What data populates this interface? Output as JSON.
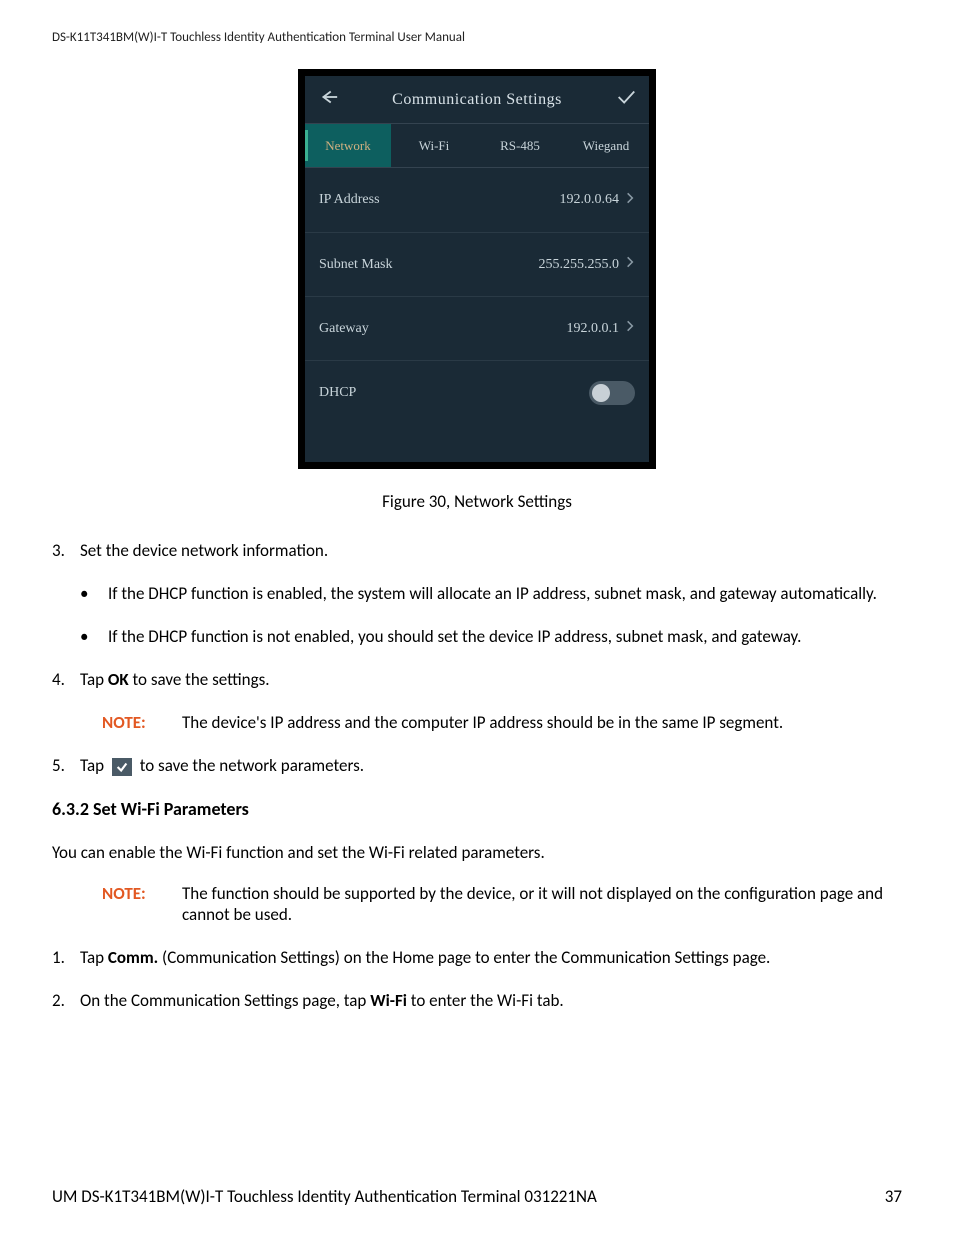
{
  "header": "DS-K11T341BM(W)I-T Touchless Identity Authentication Terminal User Manual",
  "device": {
    "title": "Communication Settings",
    "tabs": [
      "Network",
      "Wi-Fi",
      "RS-485",
      "Wiegand"
    ],
    "rows": {
      "ip": {
        "label": "IP Address",
        "value": "192.0.0.64"
      },
      "subnet": {
        "label": "Subnet Mask",
        "value": "255.255.255.0"
      },
      "gateway": {
        "label": "Gateway",
        "value": "192.0.0.1"
      },
      "dhcp": {
        "label": "DHCP"
      }
    }
  },
  "figure_caption": "Figure 30, Network Settings",
  "steps": {
    "s3": {
      "num": "3.",
      "text": "Set the device network information."
    },
    "bullets": {
      "b1": "If the DHCP function is enabled, the system will allocate an IP address, subnet mask, and gateway automatically.",
      "b2": "If the DHCP function is not enabled, you should set the device IP address, subnet mask, and gateway."
    },
    "s4": {
      "num": "4.",
      "pre": "Tap ",
      "bold": "OK",
      "post": " to save the settings."
    },
    "note1": {
      "label": "NOTE:",
      "text": "The device's IP address and the computer IP address should be in the same IP segment."
    },
    "s5": {
      "num": "5.",
      "pre": "Tap ",
      "post": " to save the network parameters."
    }
  },
  "section": {
    "heading": "6.3.2 Set Wi-Fi Parameters",
    "intro": "You can enable the Wi-Fi function and set the Wi-Fi related parameters.",
    "note2": {
      "label": "NOTE:",
      "text": "The function should be supported by the device, or it will not displayed on the configuration page and cannot be used."
    },
    "s1": {
      "num": "1.",
      "pre": "Tap ",
      "bold": "Comm.",
      "post": " (Communication Settings) on the Home page to enter the Communication Settings page."
    },
    "s2": {
      "num": "2.",
      "pre": "On the Communication Settings page, tap ",
      "bold": "Wi-Fi",
      "post": " to enter the Wi-Fi tab."
    }
  },
  "footer": {
    "left": "UM DS-K1T341BM(W)I-T Touchless Identity Authentication Terminal 031221NA",
    "right": "37"
  }
}
